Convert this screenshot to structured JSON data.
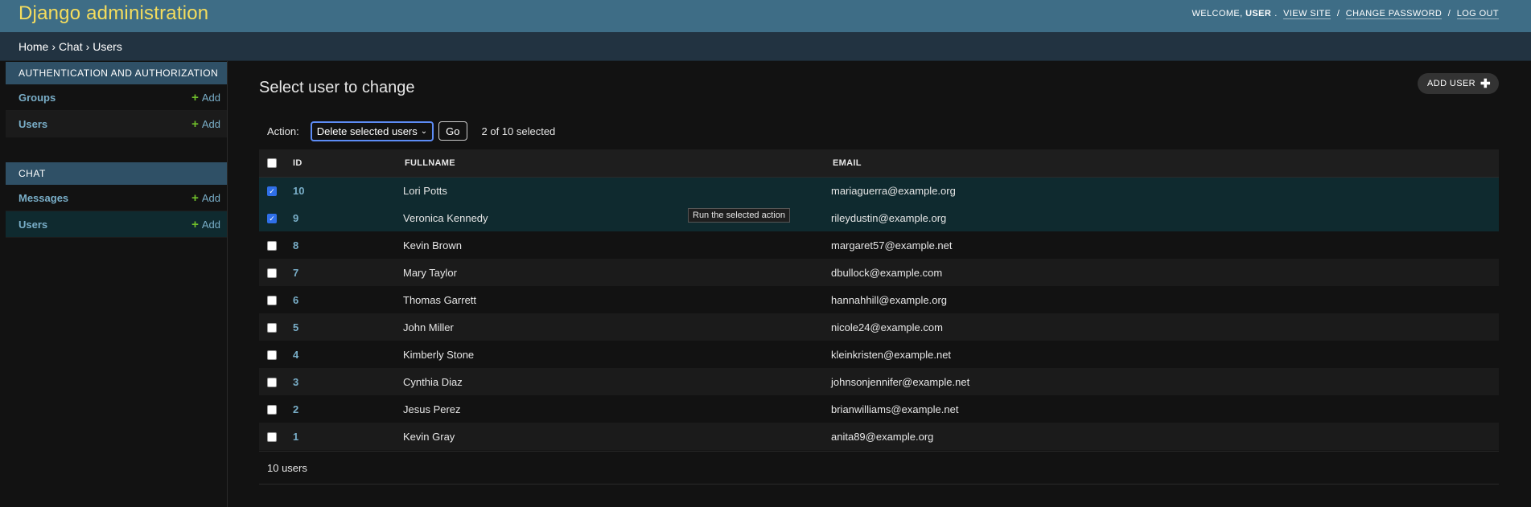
{
  "header": {
    "brand": "Django administration",
    "welcome": "WELCOME,",
    "username": "USER",
    "links": [
      "VIEW SITE",
      "CHANGE PASSWORD",
      "LOG OUT"
    ]
  },
  "breadcrumbs": [
    "Home",
    "Chat",
    "Users"
  ],
  "sidebar": {
    "modules": [
      {
        "caption": "AUTHENTICATION AND AUTHORIZATION",
        "items": [
          {
            "label": "Groups",
            "add": "Add"
          },
          {
            "label": "Users",
            "add": "Add"
          }
        ]
      },
      {
        "caption": "CHAT",
        "items": [
          {
            "label": "Messages",
            "add": "Add"
          },
          {
            "label": "Users",
            "add": "Add"
          }
        ]
      }
    ]
  },
  "content": {
    "title": "Select user to change",
    "add_button": "ADD USER",
    "action_label": "Action:",
    "action_selected": "Delete selected users",
    "go_label": "Go",
    "selection_count": "2 of 10 selected",
    "tooltip": "Run the selected action",
    "columns": [
      "ID",
      "FULLNAME",
      "EMAIL"
    ],
    "rows": [
      {
        "id": "10",
        "fullname": "Lori Potts",
        "email": "mariaguerra@example.org",
        "checked": true
      },
      {
        "id": "9",
        "fullname": "Veronica Kennedy",
        "email": "rileydustin@example.org",
        "checked": true
      },
      {
        "id": "8",
        "fullname": "Kevin Brown",
        "email": "margaret57@example.net",
        "checked": false
      },
      {
        "id": "7",
        "fullname": "Mary Taylor",
        "email": "dbullock@example.com",
        "checked": false
      },
      {
        "id": "6",
        "fullname": "Thomas Garrett",
        "email": "hannahhill@example.org",
        "checked": false
      },
      {
        "id": "5",
        "fullname": "John Miller",
        "email": "nicole24@example.com",
        "checked": false
      },
      {
        "id": "4",
        "fullname": "Kimberly Stone",
        "email": "kleinkristen@example.net",
        "checked": false
      },
      {
        "id": "3",
        "fullname": "Cynthia Diaz",
        "email": "johnsonjennifer@example.net",
        "checked": false
      },
      {
        "id": "2",
        "fullname": "Jesus Perez",
        "email": "brianwilliams@example.net",
        "checked": false
      },
      {
        "id": "1",
        "fullname": "Kevin Gray",
        "email": "anita89@example.org",
        "checked": false
      }
    ],
    "paginator": "10 users"
  },
  "colors": {
    "header_bg": "#3e6d86",
    "brand": "#f5dd5d",
    "link": "#79aec8",
    "add_green": "#70bf2b",
    "selected_row": "#0f2a2f"
  }
}
